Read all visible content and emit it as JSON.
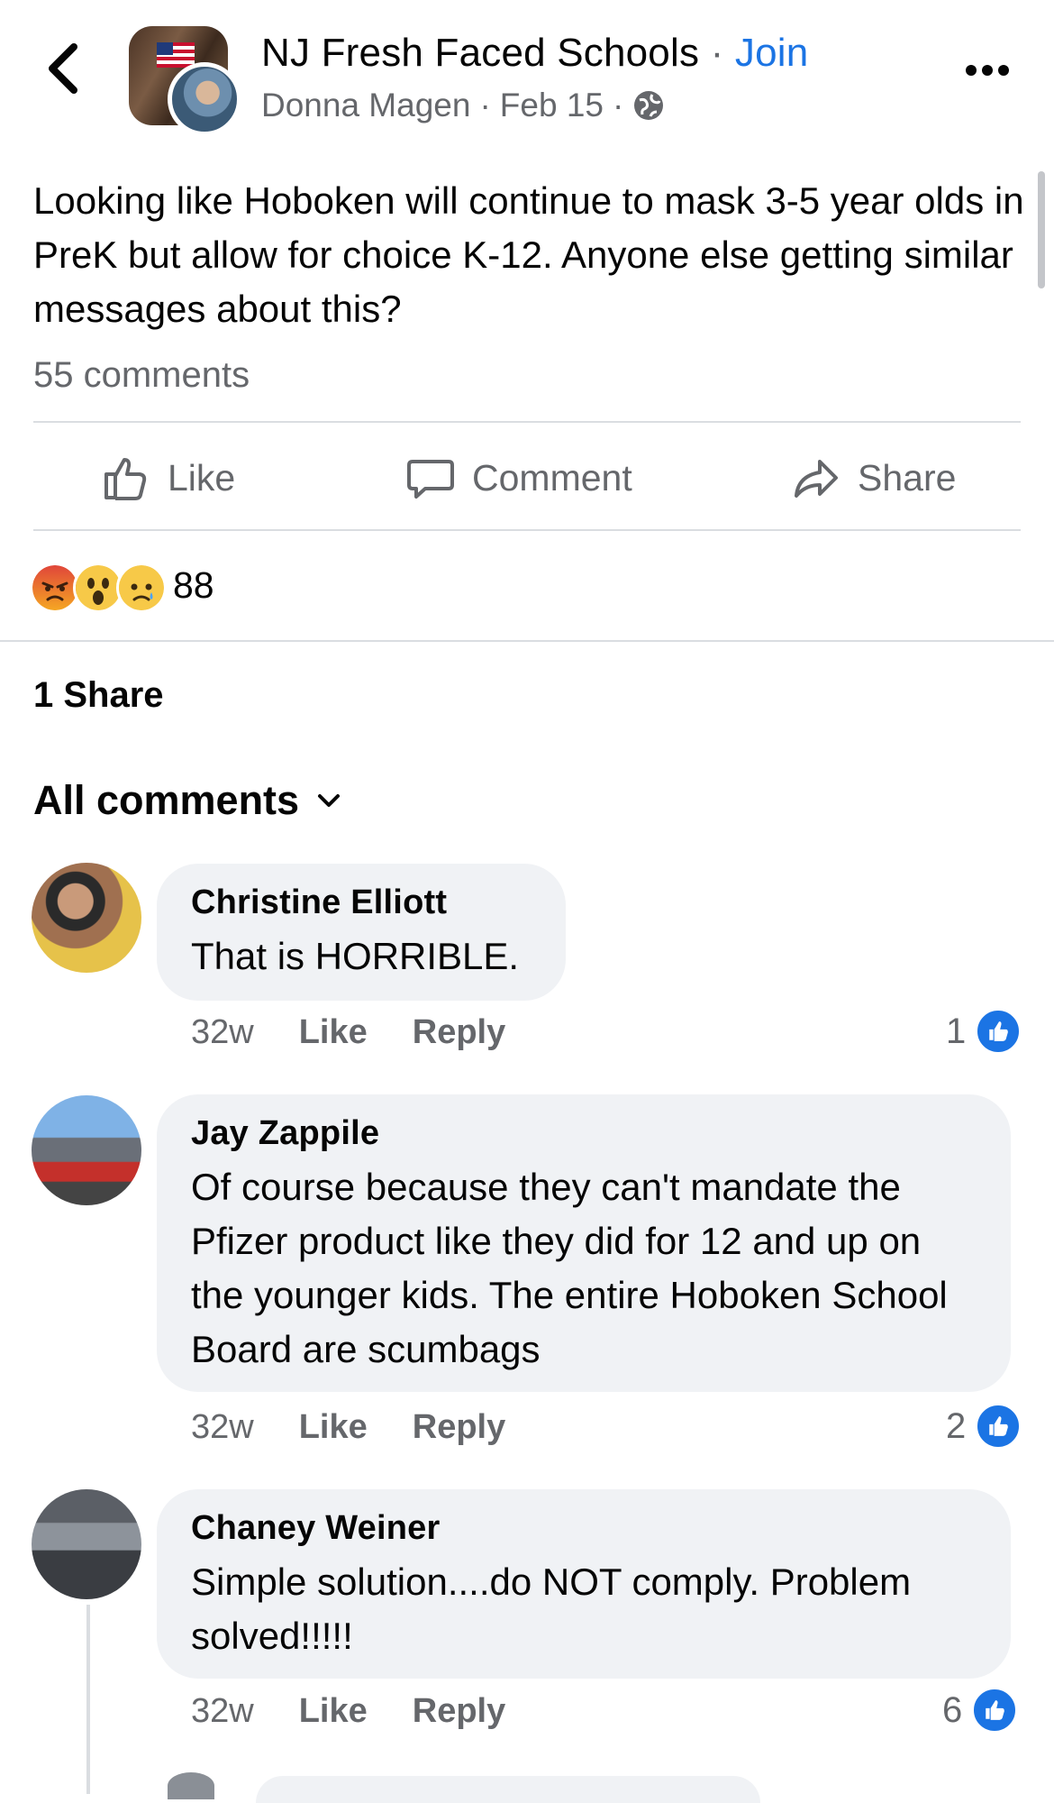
{
  "header": {
    "group_name": "NJ Fresh Faced Schools",
    "separator": "·",
    "join_label": "Join",
    "author": "Donna Magen",
    "date": "Feb 15",
    "meta_sep": "·"
  },
  "post": {
    "text": "Looking like Hoboken will continue to mask 3-5 year olds in PreK but allow for choice K-12. Anyone else getting similar messages about this?",
    "comment_count": "55 comments"
  },
  "actions": {
    "like_label": "Like",
    "comment_label": "Comment",
    "share_label": "Share"
  },
  "reactions": {
    "types": [
      "angry",
      "wow",
      "sad"
    ],
    "count": "88"
  },
  "shares": "1 Share",
  "comments_filter": "All comments",
  "comments": [
    {
      "name": "Christine Elliott",
      "text": "That is HORRIBLE.",
      "time": "32w",
      "like_label": "Like",
      "reply_label": "Reply",
      "likes": "1"
    },
    {
      "name": "Jay Zappile",
      "text": "Of course because they can't mandate the Pfizer product like they did for 12 and up on the younger kids. The entire Hoboken School Board are scumbags",
      "time": "32w",
      "like_label": "Like",
      "reply_label": "Reply",
      "likes": "2"
    },
    {
      "name": "Chaney Weiner",
      "text": "Simple solution....do NOT comply. Problem solved!!!!!",
      "time": "32w",
      "like_label": "Like",
      "reply_label": "Reply",
      "likes": "6"
    }
  ],
  "colors": {
    "accent": "#1b74e4",
    "secondary_text": "#65676b",
    "bubble": "#f0f2f5",
    "divider": "#dadde1"
  }
}
